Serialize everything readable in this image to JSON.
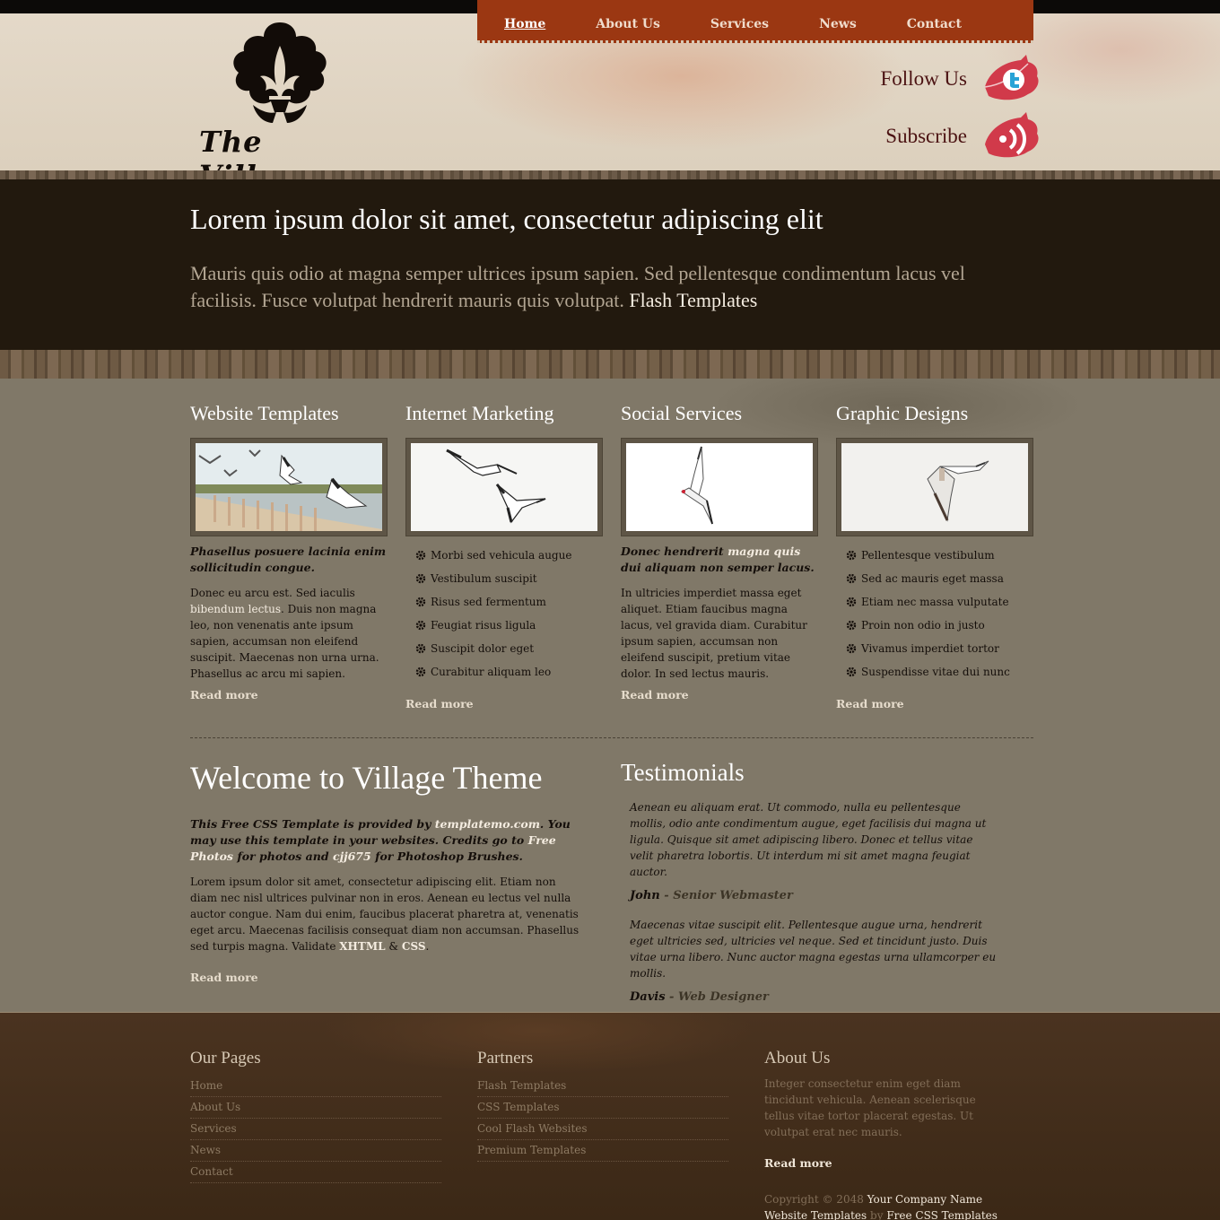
{
  "site": {
    "logo_text": "The Village",
    "colors": {
      "nav_bg": "#9b3712",
      "hero_bg": "#22190e",
      "content_bg": "#807868",
      "footer_bg": "#3b2816",
      "social_leaf": "#d13a4a"
    }
  },
  "nav": {
    "items": [
      "Home",
      "About Us",
      "Services",
      "News",
      "Contact"
    ],
    "active": "Home"
  },
  "social": {
    "follow_label": "Follow Us",
    "follow_icon": "twitter-leaf-icon",
    "subscribe_label": "Subscribe",
    "subscribe_icon": "rss-leaf-icon"
  },
  "hero": {
    "title": "Lorem ipsum dolor sit amet, consectetur adipiscing elit",
    "text": "Mauris quis odio at magna semper ultrices ipsum sapien. Sed pellentesque condimentum lacus vel facilisis. Fusce volutpat hendrerit mauris quis volutpat.",
    "link": "Flash Templates"
  },
  "columns": [
    {
      "title": "Website Templates",
      "lead": "Phasellus posuere lacinia enim sollicitudin congue.",
      "body_pre": "Donec eu arcu est. Sed iaculis",
      "body_link": "bibendum lectus",
      "body_post": ". Duis non magna leo, non venenatis ante ipsum sapien, accumsan non eleifend suscipit. Maecenas non urna urna. Phasellus ac arcu mi sapien.",
      "read_more": "Read more"
    },
    {
      "title": "Internet Marketing",
      "list": [
        "Morbi sed vehicula augue",
        "Vestibulum suscipit",
        "Risus sed fermentum",
        "Feugiat risus ligula",
        "Suscipit dolor eget",
        "Curabitur aliquam leo"
      ],
      "read_more": "Read more"
    },
    {
      "title": "Social Services",
      "lead_pre": "Donec hendrerit",
      "lead_link": "magna quis",
      "lead_post": "dui aliquam non semper lacus.",
      "body": "In ultricies imperdiet massa eget aliquet. Etiam faucibus magna lacus, vel gravida diam. Curabitur ipsum sapien, accumsan non eleifend suscipit, pretium vitae dolor. In sed lectus mauris.",
      "read_more": "Read more"
    },
    {
      "title": "Graphic Designs",
      "list": [
        "Pellentesque vestibulum",
        "Sed ac mauris eget massa",
        "Etiam nec massa vulputate",
        "Proin non odio in justo",
        "Vivamus imperdiet tortor",
        "Suspendisse vitae dui nunc"
      ],
      "read_more": "Read more"
    }
  ],
  "welcome": {
    "title": "Welcome to Village Theme",
    "lead_1": "This Free CSS Template is provided by",
    "lead_link_1": "templatemo.com",
    "lead_2": ". You may use this template in your websites. Credits go to",
    "lead_link_2": "Free Photos",
    "lead_3": "for photos and",
    "lead_link_3": "cjj675",
    "lead_4": "for Photoshop Brushes.",
    "body": "Lorem ipsum dolor sit amet, consectetur adipiscing elit. Etiam non diam nec nisl ultrices pulvinar non in eros. Aenean eu lectus vel nulla auctor congue. Nam dui enim, faucibus placerat pharetra at, venenatis eget arcu. Maecenas facilisis consequat diam non accumsan. Phasellus sed turpis magna. Validate",
    "body_link_1": "XHTML",
    "body_amp": "&",
    "body_link_2": "CSS",
    "body_end": ".",
    "read_more": "Read more"
  },
  "testimonials": {
    "title": "Testimonials",
    "items": [
      {
        "quote": "Aenean eu aliquam erat. Ut commodo, nulla eu pellentesque mollis, odio ante condimentum augue, eget facilisis dui magna ut ligula. Quisque sit amet adipiscing libero. Donec et tellus vitae velit pharetra lobortis. Ut interdum mi sit amet magna feugiat auctor.",
        "name": "John",
        "sep": " - ",
        "role": "Senior Webmaster"
      },
      {
        "quote": "Maecenas vitae suscipit elit. Pellentesque augue urna, hendrerit eget ultricies sed, ultricies vel neque. Sed et tincidunt justo. Duis vitae urna libero. Nunc auctor magna egestas urna ullamcorper eu mollis.",
        "name": "Davis",
        "sep": " - ",
        "role": "Web Designer"
      }
    ]
  },
  "footer": {
    "pages_title": "Our Pages",
    "pages": [
      "Home",
      "About Us",
      "Services",
      "News",
      "Contact"
    ],
    "partners_title": "Partners",
    "partners": [
      "Flash Templates",
      "CSS Templates",
      "Cool Flash Websites",
      "Premium Templates"
    ],
    "about_title": "About Us",
    "about_text": "Integer consectetur enim eget diam tincidunt vehicula. Aenean scelerisque tellus vitae tortor placerat egestas. Ut volutpat erat nec mauris.",
    "read_more": "Read more",
    "copyright_pre": "Copyright © 2048",
    "company": "Your Company Name",
    "credit_link_1": "Website Templates",
    "credit_by": "by",
    "credit_link_2": "Free CSS Templates"
  }
}
